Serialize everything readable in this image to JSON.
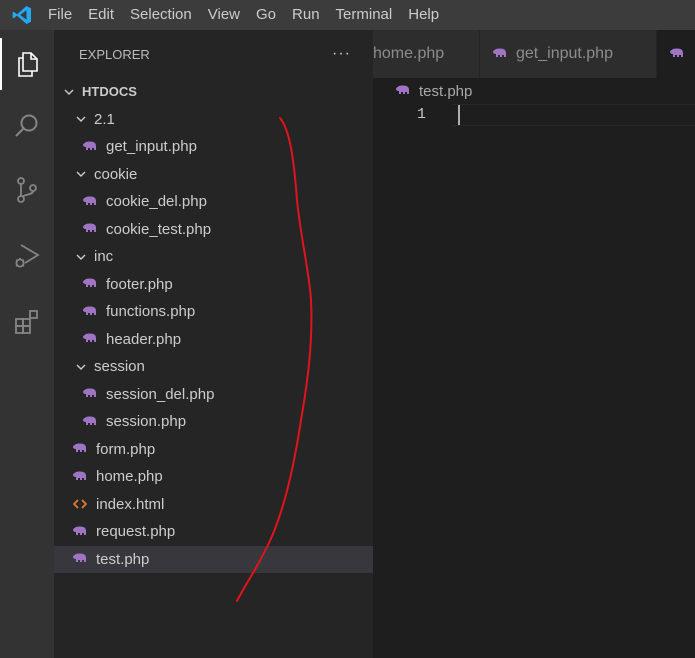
{
  "menubar": {
    "items": [
      "File",
      "Edit",
      "Selection",
      "View",
      "Go",
      "Run",
      "Terminal",
      "Help"
    ]
  },
  "activitybar": {
    "icons": [
      "explorer-icon",
      "search-icon",
      "source-control-icon",
      "run-debug-icon",
      "extensions-icon"
    ]
  },
  "sidebar": {
    "title": "EXPLORER",
    "more": "···",
    "root": "HTDOCS",
    "tree": [
      {
        "label": "2.1",
        "type": "folder",
        "depth": 1
      },
      {
        "label": "get_input.php",
        "type": "php",
        "depth": 2
      },
      {
        "label": "cookie",
        "type": "folder",
        "depth": 1
      },
      {
        "label": "cookie_del.php",
        "type": "php",
        "depth": 2
      },
      {
        "label": "cookie_test.php",
        "type": "php",
        "depth": 2
      },
      {
        "label": "inc",
        "type": "folder",
        "depth": 1
      },
      {
        "label": "footer.php",
        "type": "php",
        "depth": 2
      },
      {
        "label": "functions.php",
        "type": "php",
        "depth": 2
      },
      {
        "label": "header.php",
        "type": "php",
        "depth": 2
      },
      {
        "label": "session",
        "type": "folder",
        "depth": 1
      },
      {
        "label": "session_del.php",
        "type": "php",
        "depth": 2
      },
      {
        "label": "session.php",
        "type": "php",
        "depth": 2
      },
      {
        "label": "form.php",
        "type": "php",
        "depth": 1
      },
      {
        "label": "home.php",
        "type": "php",
        "depth": 1
      },
      {
        "label": "index.html",
        "type": "html",
        "depth": 1
      },
      {
        "label": "request.php",
        "type": "php",
        "depth": 1
      },
      {
        "label": "test.php",
        "type": "php",
        "depth": 1,
        "selected": true
      }
    ]
  },
  "editor": {
    "tabs": [
      {
        "label": "home.php"
      },
      {
        "label": "get_input.php"
      },
      {
        "label": "",
        "active": true
      }
    ],
    "breadcrumb": "test.php",
    "line_number": "1"
  },
  "colors": {
    "php_icon": "#a074c4",
    "html_icon": "#e37933",
    "annotation": "#e0141b"
  }
}
